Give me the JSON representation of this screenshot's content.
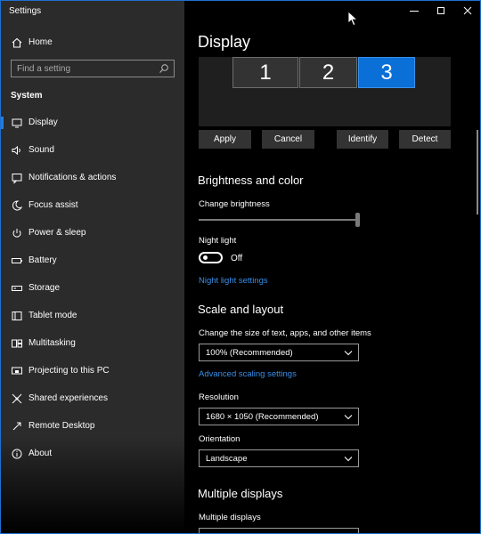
{
  "window": {
    "title": "Settings"
  },
  "sidebar": {
    "home_label": "Home",
    "search_placeholder": "Find a setting",
    "section_label": "System",
    "items": [
      {
        "label": "Display"
      },
      {
        "label": "Sound"
      },
      {
        "label": "Notifications & actions"
      },
      {
        "label": "Focus assist"
      },
      {
        "label": "Power & sleep"
      },
      {
        "label": "Battery"
      },
      {
        "label": "Storage"
      },
      {
        "label": "Tablet mode"
      },
      {
        "label": "Multitasking"
      },
      {
        "label": "Projecting to this PC"
      },
      {
        "label": "Shared experiences"
      },
      {
        "label": "Remote Desktop"
      },
      {
        "label": "About"
      }
    ]
  },
  "main": {
    "title": "Display",
    "monitors": [
      "1",
      "2",
      "3"
    ],
    "selected_monitor": "3",
    "buttons": {
      "apply": "Apply",
      "cancel": "Cancel",
      "identify": "Identify",
      "detect": "Detect"
    },
    "brightness": {
      "heading": "Brightness and color",
      "change_label": "Change brightness",
      "level_percent": 100,
      "night_light_label": "Night light",
      "night_light_state": "Off",
      "night_light_link": "Night light settings"
    },
    "scale": {
      "heading": "Scale and layout",
      "size_label": "Change the size of text, apps, and other items",
      "size_value": "100% (Recommended)",
      "advanced_link": "Advanced scaling settings",
      "resolution_label": "Resolution",
      "resolution_value": "1680 × 1050 (Recommended)",
      "orientation_label": "Orientation",
      "orientation_value": "Landscape"
    },
    "multiple": {
      "heading": "Multiple displays",
      "label": "Multiple displays"
    }
  },
  "colors": {
    "accent": "#0a6fd6",
    "link": "#3a8fe8",
    "sidebar_bg": "#2b2b2b",
    "main_bg": "#000000"
  }
}
